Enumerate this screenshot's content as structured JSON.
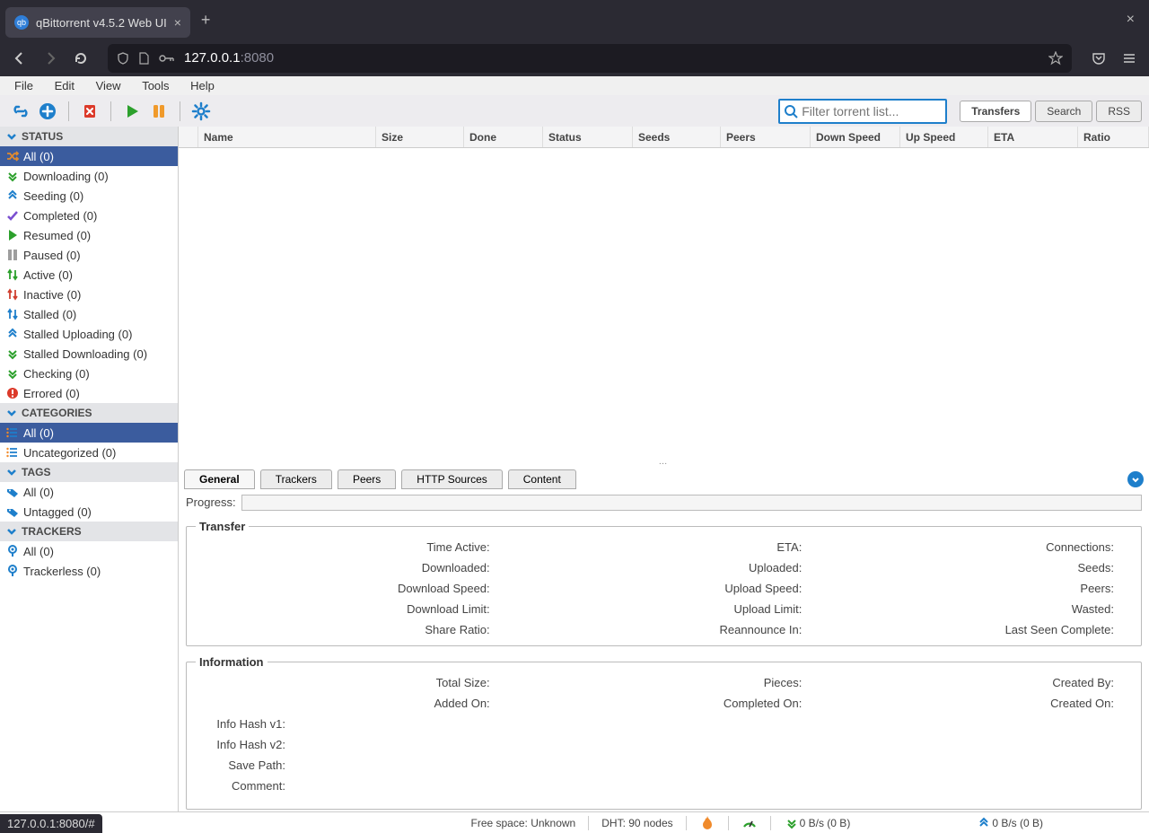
{
  "browser": {
    "tab_title": "qBittorrent v4.5.2 Web UI",
    "url_host": "127.0.0.1",
    "url_port": ":8080"
  },
  "menubar": [
    "File",
    "Edit",
    "View",
    "Tools",
    "Help"
  ],
  "search_placeholder": "Filter torrent list...",
  "view_tabs": {
    "transfers": "Transfers",
    "search": "Search",
    "rss": "RSS"
  },
  "sidebar": {
    "status_title": "STATUS",
    "status": [
      {
        "label": "All (0)",
        "icon": "shuffle",
        "tone": "#e08a2f"
      },
      {
        "label": "Downloading (0)",
        "icon": "dchev",
        "tone": "#2ca02c"
      },
      {
        "label": "Seeding (0)",
        "icon": "uchev",
        "tone": "#1e7fcb"
      },
      {
        "label": "Completed (0)",
        "icon": "check",
        "tone": "#7a4fd0"
      },
      {
        "label": "Resumed (0)",
        "icon": "play",
        "tone": "#2ca02c"
      },
      {
        "label": "Paused (0)",
        "icon": "pause",
        "tone": "#9e9e9e"
      },
      {
        "label": "Active (0)",
        "icon": "updown",
        "tone": "#2ca02c"
      },
      {
        "label": "Inactive (0)",
        "icon": "updown",
        "tone": "#d04030"
      },
      {
        "label": "Stalled (0)",
        "icon": "updown",
        "tone": "#1e7fcb"
      },
      {
        "label": "Stalled Uploading (0)",
        "icon": "uchev",
        "tone": "#1e7fcb"
      },
      {
        "label": "Stalled Downloading (0)",
        "icon": "dchev",
        "tone": "#2ca02c"
      },
      {
        "label": "Checking (0)",
        "icon": "dchev",
        "tone": "#2ca02c"
      },
      {
        "label": "Errored (0)",
        "icon": "error",
        "tone": "#dc3a2a"
      }
    ],
    "categories_title": "CATEGORIES",
    "categories": [
      {
        "label": "All (0)"
      },
      {
        "label": "Uncategorized (0)"
      }
    ],
    "tags_title": "TAGS",
    "tags": [
      {
        "label": "All (0)"
      },
      {
        "label": "Untagged (0)"
      }
    ],
    "trackers_title": "TRACKERS",
    "trackers": [
      {
        "label": "All (0)"
      },
      {
        "label": "Trackerless (0)"
      }
    ]
  },
  "table": {
    "cols": [
      "Name",
      "Size",
      "Done",
      "Status",
      "Seeds",
      "Peers",
      "Down Speed",
      "Up Speed",
      "ETA",
      "Ratio"
    ]
  },
  "detail_tabs": {
    "general": "General",
    "trackers": "Trackers",
    "peers": "Peers",
    "http": "HTTP Sources",
    "content": "Content"
  },
  "detail": {
    "progress_label": "Progress:",
    "transfer_title": "Transfer",
    "transfer_rows": [
      [
        "Time Active:",
        "ETA:",
        "Connections:"
      ],
      [
        "Downloaded:",
        "Uploaded:",
        "Seeds:"
      ],
      [
        "Download Speed:",
        "Upload Speed:",
        "Peers:"
      ],
      [
        "Download Limit:",
        "Upload Limit:",
        "Wasted:"
      ],
      [
        "Share Ratio:",
        "Reannounce In:",
        "Last Seen Complete:"
      ]
    ],
    "info_title": "Information",
    "info_rows3": [
      [
        "Total Size:",
        "Pieces:",
        "Created By:"
      ],
      [
        "Added On:",
        "Completed On:",
        "Created On:"
      ]
    ],
    "info_rows1": [
      "Info Hash v1:",
      "Info Hash v2:",
      "Save Path:",
      "Comment:"
    ]
  },
  "status": {
    "free": "Free space: Unknown",
    "dht": "DHT: 90 nodes",
    "down": "0 B/s (0 B)",
    "up": "0 B/s (0 B)"
  },
  "footer_url": "127.0.0.1:8080/#"
}
